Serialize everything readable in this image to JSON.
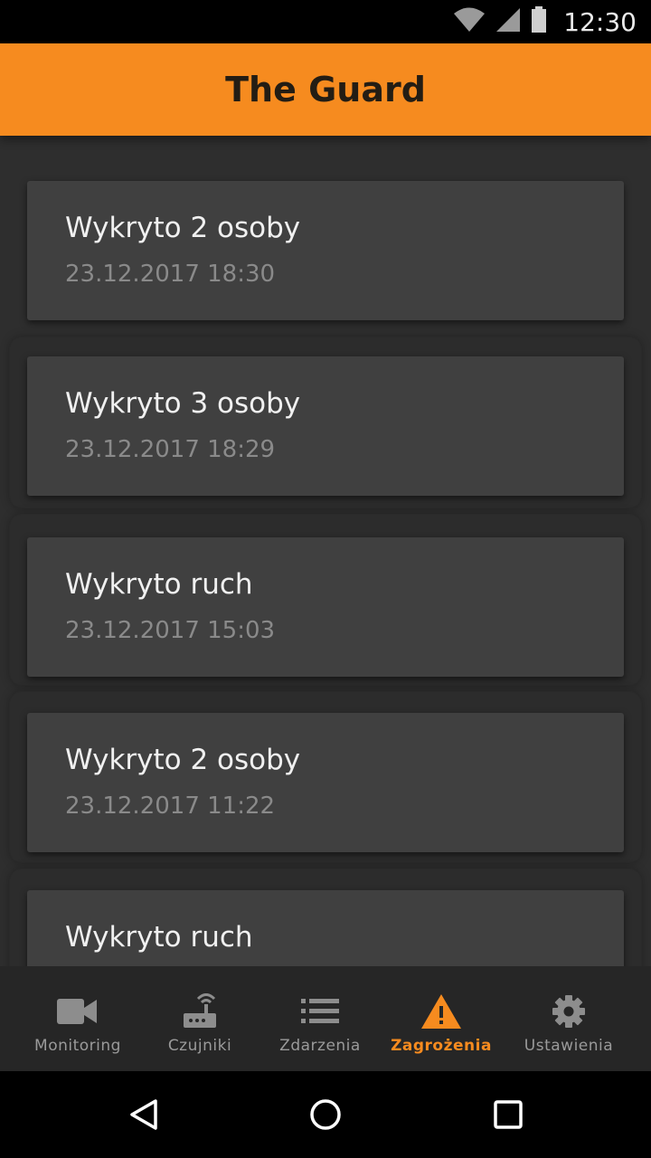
{
  "status_bar": {
    "time": "12:30",
    "icons": [
      "wifi-icon",
      "signal-icon",
      "battery-icon"
    ]
  },
  "app_bar": {
    "title": "The Guard",
    "color": "#f68b1f"
  },
  "events": [
    {
      "title": "Wykryto 2 osoby",
      "date": "23.12.2017 18:30"
    },
    {
      "title": "Wykryto 3 osoby",
      "date": "23.12.2017 18:29"
    },
    {
      "title": "Wykryto ruch",
      "date": "23.12.2017 15:03"
    },
    {
      "title": "Wykryto 2 osoby",
      "date": "23.12.2017 11:22"
    },
    {
      "title": "Wykryto ruch",
      "date": ""
    }
  ],
  "bottom_nav": {
    "items": [
      {
        "label": "Monitoring",
        "icon": "video-camera-icon"
      },
      {
        "label": "Czujniki",
        "icon": "router-icon"
      },
      {
        "label": "Zdarzenia",
        "icon": "list-icon"
      },
      {
        "label": "Zagrożenia",
        "icon": "warning-icon",
        "active": true
      },
      {
        "label": "Ustawienia",
        "icon": "gear-icon"
      }
    ],
    "active_color": "#f68b1f"
  },
  "system_nav": {
    "icons": [
      "back-icon",
      "home-icon",
      "recents-icon"
    ]
  }
}
